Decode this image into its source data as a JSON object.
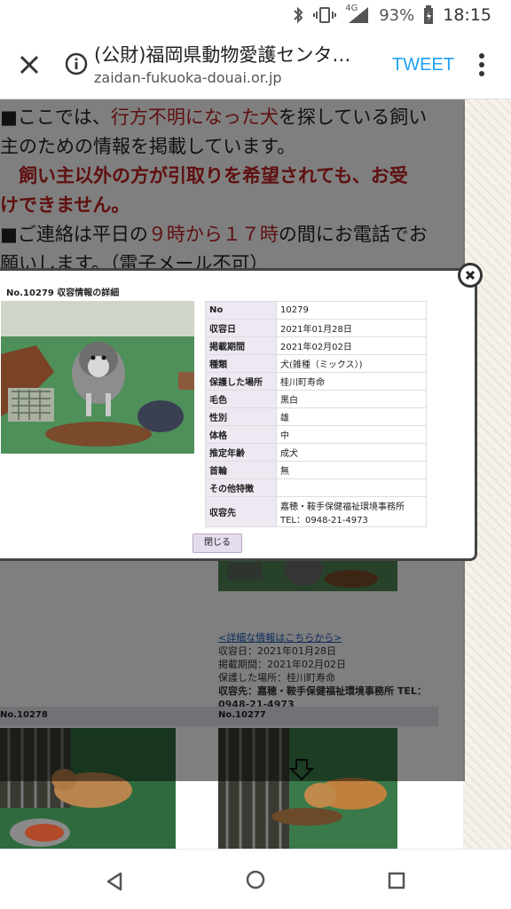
{
  "status": {
    "signal_label": "4G",
    "battery_percent": "93%",
    "time": "18:15"
  },
  "appbar": {
    "title": "(公財)福岡県動物愛護センタ…",
    "url": "zaidan-fukuoka-douai.or.jp",
    "tweet_label": "TWEET"
  },
  "notice": {
    "line1_a": "■ここでは、",
    "line1_red": "行方不明になった犬",
    "line1_b": "を探している飼い",
    "line2": "主のための情報を掲載しています。",
    "line3": "　飼い主以外の方が引取りを希望されても、お受",
    "line4": "けできません。",
    "line5_a": "■ご連絡は平日の",
    "line5_red": "９時から１７時",
    "line5_b": "の間にお電話でお",
    "line6": "願いします。（電子メール不可）"
  },
  "modal": {
    "title": "No.10279 収容情報の詳細",
    "rows": [
      {
        "k": "No",
        "v": "10279"
      },
      {
        "k": "収容日",
        "v": "2021年01月28日"
      },
      {
        "k": "掲載期間",
        "v": "2021年02月02日"
      },
      {
        "k": "種類",
        "v": "犬(雑種（ミックス）)"
      },
      {
        "k": "保護した場所",
        "v": "桂川町寿命"
      },
      {
        "k": "毛色",
        "v": "黒白"
      },
      {
        "k": "性別",
        "v": "雄"
      },
      {
        "k": "体格",
        "v": "中"
      },
      {
        "k": "推定年齢",
        "v": "成犬"
      },
      {
        "k": "首輪",
        "v": "無"
      },
      {
        "k": "その他特徴",
        "v": ""
      },
      {
        "k": "収容先",
        "v": "嘉穂・鞍手保健福祉環境事務所 TEL：0948-21-4973"
      }
    ],
    "close_label": "閉じる"
  },
  "listing": {
    "detail_link": "<詳細な情報はこちらから>",
    "line1": "収容日：2021年01月28日",
    "line2": "掲載期間：2021年02月02日",
    "line3": "保護した場所：桂川町寿命",
    "line4": "収容先：嘉穂・鞍手保健福祉環境事務所 TEL：0948-21-4973",
    "card_left_no": "No.10278",
    "card_right_no": "No.10277"
  }
}
